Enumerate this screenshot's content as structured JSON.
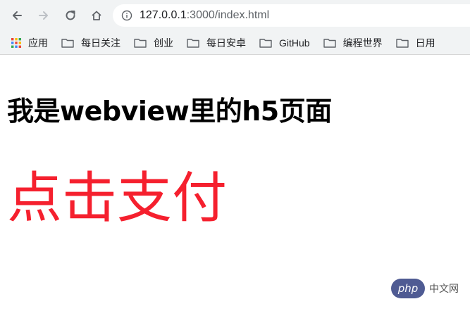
{
  "browser": {
    "url_host": "127.0.0.1",
    "url_rest": ":3000/index.html"
  },
  "bookmarks": [
    {
      "label": "应用",
      "icon": "apps-grid-icon"
    },
    {
      "label": "每日关注",
      "icon": "folder-icon"
    },
    {
      "label": "创业",
      "icon": "folder-icon"
    },
    {
      "label": "每日安卓",
      "icon": "folder-icon"
    },
    {
      "label": "GitHub",
      "icon": "folder-icon"
    },
    {
      "label": "编程世界",
      "icon": "folder-icon"
    },
    {
      "label": "日用",
      "icon": "folder-icon"
    }
  ],
  "page": {
    "heading": "我是webview里的h5页面",
    "pay_label": "点击支付"
  },
  "watermark": {
    "logo_text": "php",
    "site_text": "中文网"
  },
  "colors": {
    "pay_text": "#f5202e",
    "toolbar_bg": "#f1f3f4",
    "watermark_logo": "#4f5b93"
  }
}
